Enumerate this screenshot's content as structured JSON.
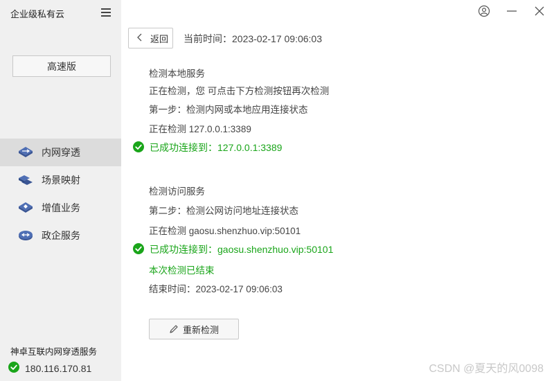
{
  "sidebar": {
    "app_title": "企业级私有云",
    "edition_button": "高速版",
    "nav": [
      {
        "label": "内网穿透",
        "icon": "tunnel-icon",
        "active": true
      },
      {
        "label": "场景映射",
        "icon": "scene-mapping-icon",
        "active": false
      },
      {
        "label": "增值业务",
        "icon": "value-added-icon",
        "active": false
      },
      {
        "label": "政企服务",
        "icon": "enterprise-service-icon",
        "active": false
      }
    ],
    "service_name": "神卓互联内网穿透服务",
    "service_ip": "180.116.170.81"
  },
  "header": {
    "back_label": "返回",
    "current_time": "当前时间：2023-02-17 09:06:03"
  },
  "check": {
    "local_title": "检测本地服务",
    "local_desc": "正在检测，您 可点击下方检测按钮再次检测",
    "step1": "第一步：检测内网或本地应用连接状态",
    "checking_local": "正在检测 127.0.0.1:3389",
    "local_success": "已成功连接到：127.0.0.1:3389",
    "remote_title": "检测访问服务",
    "step2": "第二步：检测公网访问地址连接状态",
    "checking_remote": "正在检测 gaosu.shenzhuo.vip:50101",
    "remote_success": "已成功连接到：gaosu.shenzhuo.vip:50101",
    "ended": "本次检测已结束",
    "end_time": "结束时间：2023-02-17 09:06:03"
  },
  "recheck_label": "重新检测",
  "watermark": "CSDN @夏天的风0098",
  "colors": {
    "success": "#1aa51a",
    "icon_blue": "#4f6fb4",
    "sidebar_bg": "#f0f0f0",
    "active_bg": "#dcdcdc"
  }
}
